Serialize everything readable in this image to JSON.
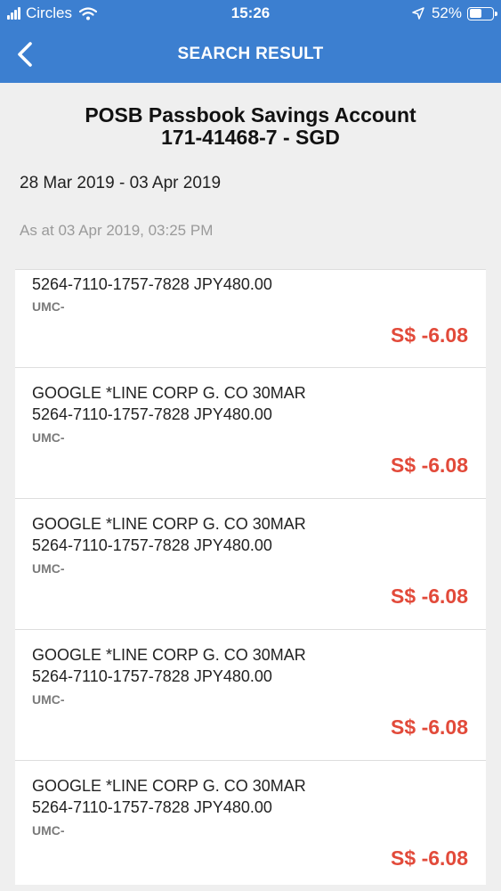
{
  "status_bar": {
    "carrier": "Circles",
    "time": "15:26",
    "battery": "52%",
    "battery_level": 0.52
  },
  "nav": {
    "back_icon": "chevron-left-icon",
    "title": "SEARCH RESULT"
  },
  "account": {
    "name": "POSB Passbook Savings Account",
    "number": "171-41468-7 - SGD",
    "date_range": "28 Mar 2019 - 03 Apr 2019",
    "as_at": "As at 03 Apr 2019, 03:25 PM"
  },
  "transactions": [
    {
      "line2": "5264-7110-1757-7828 JPY480.00",
      "code": "UMC-",
      "amount": "S$ -6.08"
    },
    {
      "line1": "GOOGLE *LINE CORP G. CO 30MAR",
      "line2": "5264-7110-1757-7828 JPY480.00",
      "code": "UMC-",
      "amount": "S$ -6.08"
    },
    {
      "line1": "GOOGLE *LINE CORP G. CO 30MAR",
      "line2": "5264-7110-1757-7828 JPY480.00",
      "code": "UMC-",
      "amount": "S$ -6.08"
    },
    {
      "line1": "GOOGLE *LINE CORP G. CO 30MAR",
      "line2": "5264-7110-1757-7828 JPY480.00",
      "code": "UMC-",
      "amount": "S$ -6.08"
    },
    {
      "line1": "GOOGLE *LINE CORP G. CO 30MAR",
      "line2": "5264-7110-1757-7828 JPY480.00",
      "code": "UMC-",
      "amount": "S$ -6.08"
    }
  ],
  "colors": {
    "header_blue": "#3c7fd0",
    "amount_red": "#e24a3a"
  }
}
